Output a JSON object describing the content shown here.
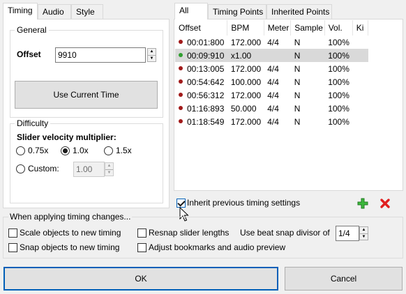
{
  "left_tabs": [
    "Timing",
    "Audio",
    "Style"
  ],
  "general": {
    "title": "General",
    "offset_label": "Offset",
    "offset_value": "9910",
    "use_current_time": "Use Current Time"
  },
  "difficulty": {
    "title": "Difficulty",
    "multiplier_label": "Slider velocity multiplier:",
    "options": [
      "0.75x",
      "1.0x",
      "1.5x"
    ],
    "selected": "1.0x",
    "custom_label": "Custom:",
    "custom_value": "1.00"
  },
  "right_tabs": [
    "All",
    "Timing Points",
    "Inherited Points"
  ],
  "table": {
    "columns": [
      "Offset",
      "BPM",
      "Meter",
      "Sample",
      "Vol.",
      "Ki"
    ],
    "rows": [
      {
        "offset": "00:01:800",
        "bpm": "172.000",
        "meter": "4/4",
        "sample": "N",
        "vol": "100%",
        "dot": "#a11a1a"
      },
      {
        "offset": "00:09:910",
        "bpm": "x1.00",
        "meter": "",
        "sample": "N",
        "vol": "100%",
        "dot": "#2f9e2f",
        "selected": true
      },
      {
        "offset": "00:13:005",
        "bpm": "172.000",
        "meter": "4/4",
        "sample": "N",
        "vol": "100%",
        "dot": "#a11a1a"
      },
      {
        "offset": "00:54:642",
        "bpm": "100.000",
        "meter": "4/4",
        "sample": "N",
        "vol": "100%",
        "dot": "#a11a1a"
      },
      {
        "offset": "00:56:312",
        "bpm": "172.000",
        "meter": "4/4",
        "sample": "N",
        "vol": "100%",
        "dot": "#a11a1a"
      },
      {
        "offset": "01:16:893",
        "bpm": "50.000",
        "meter": "4/4",
        "sample": "N",
        "vol": "100%",
        "dot": "#a11a1a"
      },
      {
        "offset": "01:18:549",
        "bpm": "172.000",
        "meter": "4/4",
        "sample": "N",
        "vol": "100%",
        "dot": "#a11a1a"
      }
    ]
  },
  "inherit_label": "Inherit previous timing settings",
  "applying": {
    "title": "When applying timing changes...",
    "scale_objects": "Scale objects to new timing",
    "resnap_sliders": "Resnap slider lengths",
    "snap_objects": "Snap objects to new timing",
    "adjust_bookmarks": "Adjust bookmarks and audio preview",
    "beat_snap_label": "Use beat snap divisor of",
    "beat_snap_value": "1/4"
  },
  "ok_label": "OK",
  "cancel_label": "Cancel",
  "colors": {
    "add": "#3cb83c",
    "delete": "#e02020",
    "accent": "#005fb8"
  }
}
